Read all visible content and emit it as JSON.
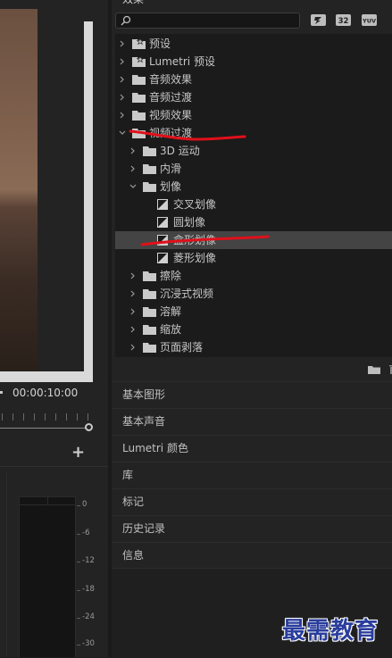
{
  "monitor": {
    "timecode": "00:00:10:00",
    "add_button": "+",
    "meter_labels": [
      "0",
      "-6",
      "-12",
      "-18",
      "-24",
      "-30"
    ]
  },
  "effects": {
    "title": "效果",
    "search": {
      "value": "",
      "placeholder": ""
    },
    "filter_icons": [
      "accelerated-effects-icon",
      "32-bit-icon",
      "yuv-icon"
    ],
    "filter_labels": [
      "",
      "32",
      "YUV"
    ],
    "tree": [
      {
        "label": "预设",
        "level": 0,
        "type": "preset-folder",
        "expanded": false
      },
      {
        "label": "Lumetri 预设",
        "level": 0,
        "type": "preset-folder",
        "expanded": false
      },
      {
        "label": "音频效果",
        "level": 0,
        "type": "folder",
        "expanded": false
      },
      {
        "label": "音频过渡",
        "level": 0,
        "type": "folder",
        "expanded": false
      },
      {
        "label": "视频效果",
        "level": 0,
        "type": "folder",
        "expanded": false
      },
      {
        "label": "视频过渡",
        "level": 0,
        "type": "folder",
        "expanded": true
      },
      {
        "label": "3D 运动",
        "level": 1,
        "type": "folder",
        "expanded": false
      },
      {
        "label": "内滑",
        "level": 1,
        "type": "folder",
        "expanded": false
      },
      {
        "label": "划像",
        "level": 1,
        "type": "folder",
        "expanded": true
      },
      {
        "label": "交叉划像",
        "level": 2,
        "type": "transition"
      },
      {
        "label": "圆划像",
        "level": 2,
        "type": "transition"
      },
      {
        "label": "盒形划像",
        "level": 2,
        "type": "transition",
        "selected": true
      },
      {
        "label": "菱形划像",
        "level": 2,
        "type": "transition"
      },
      {
        "label": "擦除",
        "level": 1,
        "type": "folder",
        "expanded": false
      },
      {
        "label": "沉浸式视频",
        "level": 1,
        "type": "folder",
        "expanded": false
      },
      {
        "label": "溶解",
        "level": 1,
        "type": "folder",
        "expanded": false
      },
      {
        "label": "缩放",
        "level": 1,
        "type": "folder",
        "expanded": false
      },
      {
        "label": "页面剥落",
        "level": 1,
        "type": "folder",
        "expanded": false
      }
    ]
  },
  "panels": [
    "基本图形",
    "基本声音",
    "Lumetri 颜色",
    "库",
    "标记",
    "历史记录",
    "信息"
  ],
  "watermark": "最需教育",
  "colors": {
    "annotation": "#e0101a",
    "watermark": "#2a3d9c",
    "selection": "#444444"
  }
}
